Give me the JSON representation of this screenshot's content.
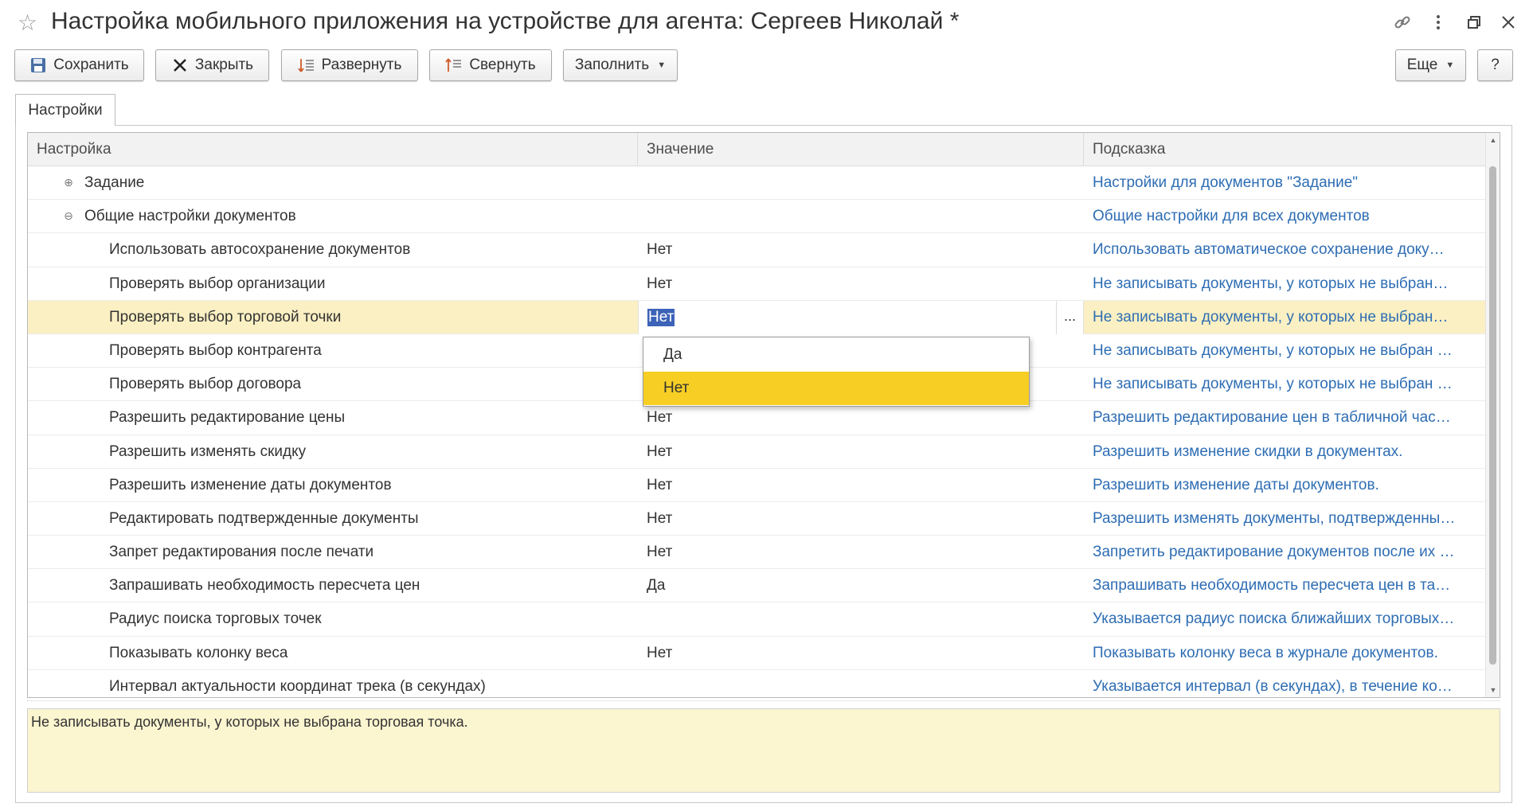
{
  "window": {
    "title": "Настройка мобильного приложения на устройстве для агента: Сергеев Николай *",
    "icons": [
      "star-icon",
      "link-icon",
      "more-vertical-icon",
      "restore-window-icon",
      "close-icon"
    ]
  },
  "toolbar": {
    "save_label": "Сохранить",
    "close_label": "Закрыть",
    "expand_label": "Развернуть",
    "collapse_label": "Свернуть",
    "fill_label": "Заполнить",
    "more_label": "Еще",
    "help_label": "?"
  },
  "tabs": [
    {
      "label": "Настройки",
      "active": true
    }
  ],
  "grid": {
    "columns": [
      "Настройка",
      "Значение",
      "Подсказка"
    ],
    "rows": [
      {
        "name": "Задание",
        "value": "",
        "hint": "Настройки для документов \"Задание\"",
        "level": 0,
        "expander": "⊕"
      },
      {
        "name": "Общие настройки документов",
        "value": "",
        "hint": "Общие настройки для всех документов",
        "level": 0,
        "expander": "⊖"
      },
      {
        "name": "Использовать автосохранение документов",
        "value": "Нет",
        "hint": "Использовать автоматическое сохранение доку…",
        "level": 1
      },
      {
        "name": "Проверять выбор организации",
        "value": "Нет",
        "hint": "Не записывать документы, у которых не выбран…",
        "level": 1
      },
      {
        "name": "Проверять выбор торговой точки",
        "value": "Нет",
        "hint": "Не записывать документы, у которых не выбран…",
        "level": 1,
        "selected": true
      },
      {
        "name": "Проверять выбор контрагента",
        "value": "",
        "hint": "Не записывать документы, у которых не выбран …",
        "level": 1
      },
      {
        "name": "Проверять выбор договора",
        "value": "",
        "hint": "Не записывать документы, у которых не выбран …",
        "level": 1
      },
      {
        "name": "Разрешить редактирование цены",
        "value": "Нет",
        "hint": "Разрешить редактирование цен в табличной час…",
        "level": 1
      },
      {
        "name": "Разрешить изменять скидку",
        "value": "Нет",
        "hint": "Разрешить изменение скидки в документах.",
        "level": 1
      },
      {
        "name": "Разрешить изменение даты документов",
        "value": "Нет",
        "hint": "Разрешить изменение даты документов.",
        "level": 1
      },
      {
        "name": "Редактировать подтвержденные документы",
        "value": "Нет",
        "hint": "Разрешить изменять документы, подтвержденны…",
        "level": 1
      },
      {
        "name": "Запрет редактирования после печати",
        "value": "Нет",
        "hint": "Запретить редактирование документов после их …",
        "level": 1
      },
      {
        "name": "Запрашивать необходимость пересчета цен",
        "value": "Да",
        "hint": "Запрашивать необходимость пересчета цен в та…",
        "level": 1
      },
      {
        "name": "Радиус поиска торговых точек",
        "value": "",
        "hint": "Указывается радиус поиска ближайших торговых…",
        "level": 1
      },
      {
        "name": "Показывать колонку веса",
        "value": "Нет",
        "hint": "Показывать колонку веса в журнале документов.",
        "level": 1
      },
      {
        "name": "Интервал актуальности координат трека (в секундах)",
        "value": "",
        "hint": "Указывается интервал (в секундах), в течение ко…",
        "level": 1
      }
    ],
    "editing": {
      "value": "Нет",
      "button": "..."
    }
  },
  "dropdown": {
    "options": [
      "Да",
      "Нет"
    ],
    "highlighted": "Нет"
  },
  "hint_box": {
    "text": "Не записывать документы, у которых не выбрана торговая точка."
  },
  "colors": {
    "hint_link": "#2e6db3",
    "selected_row": "#fbf0c3",
    "dropdown_highlight": "#f7cf24",
    "hint_box_bg": "#fbf5d0"
  }
}
